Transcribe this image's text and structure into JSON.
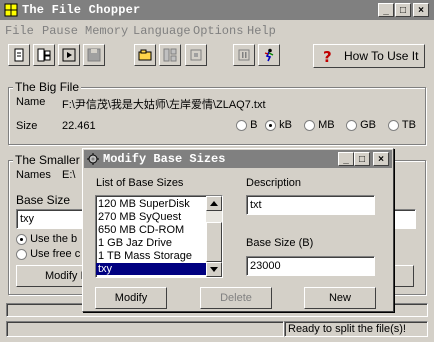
{
  "app": {
    "title": "The File Chopper",
    "window_controls": [
      "_",
      "□",
      "×"
    ]
  },
  "menu": [
    "File",
    "Pause",
    "Memory",
    "Language",
    "Options",
    "Help"
  ],
  "toolbar": {
    "how_to_label": "How To Use It"
  },
  "big_file": {
    "group_label": "The Big File",
    "name_label": "Name",
    "name_value": "F:\\尹信茂\\我是大姑师\\左岸爱情\\ZLAQ7.txt",
    "size_label": "Size",
    "size_value": "22.461",
    "units": [
      "B",
      "kB",
      "MB",
      "GB",
      "TB"
    ],
    "selected_unit": "kB"
  },
  "smaller_files": {
    "group_label": "The Smaller F",
    "names_label": "Names",
    "names_value": "E:\\",
    "base_size_label": "Base Size",
    "base_size_value": "txy",
    "radio1": "Use the b",
    "radio2": "Use free c",
    "modify_label": "Modify I"
  },
  "status": {
    "message": "Ready to split the file(s)!"
  },
  "dialog": {
    "title": "Modify Base Sizes",
    "list_label": "List of Base Sizes",
    "items": [
      "120 MB SuperDisk",
      "270 MB SyQuest",
      "650 MB CD-ROM",
      "1 GB Jaz Drive",
      "1 TB Mass Storage",
      "txy"
    ],
    "selected_item": "txy",
    "description_label": "Description",
    "description_value": "txt",
    "base_size_label": "Base Size (B)",
    "base_size_value": "23000",
    "modify_label": "Modify",
    "delete_label": "Delete",
    "new_label": "New"
  },
  "colors": {
    "face": "#d4d0c8",
    "title_inactive": "#808080",
    "selection": "#000080"
  }
}
